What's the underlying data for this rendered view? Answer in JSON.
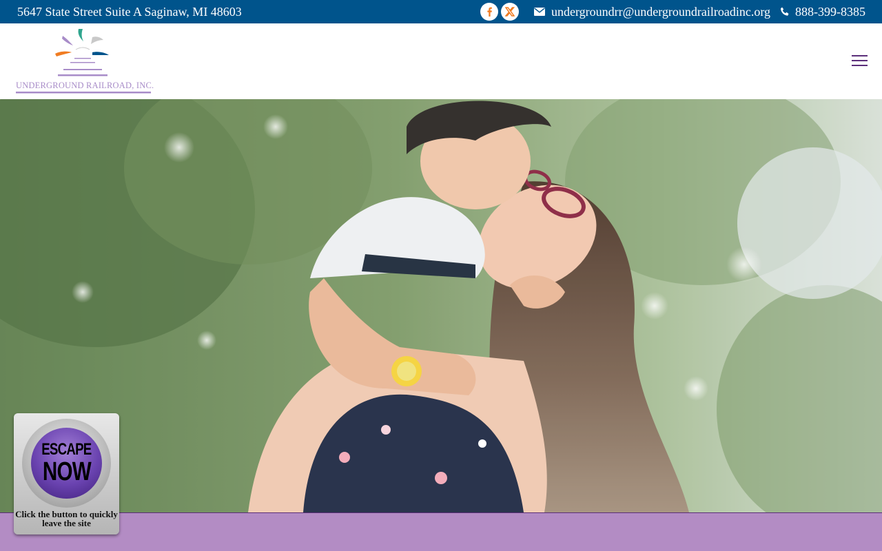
{
  "topbar": {
    "address": "5647 State Street Suite A Saginaw, MI 48603",
    "email": "undergroundrr@undergroundrailroadinc.org",
    "phone": "888-399-8385",
    "social": [
      {
        "name": "facebook",
        "glyph": "f",
        "color": "#f07c22"
      },
      {
        "name": "x-twitter",
        "glyph": "X",
        "color": "#f07c22"
      }
    ],
    "bg_color": "#00548c"
  },
  "header": {
    "logo_text": "UNDERGROUND RAILROAD, INC.",
    "menu_icon": "hamburger-icon",
    "accent_color": "#5b2e7a"
  },
  "hero": {
    "image": "mother-and-son-kiss-photo"
  },
  "escape_button": {
    "line1": "ESCAPE",
    "line2": "NOW",
    "caption": "Click the button to quickly leave the site"
  },
  "footer": {
    "bg_color": "#b38cc4"
  }
}
